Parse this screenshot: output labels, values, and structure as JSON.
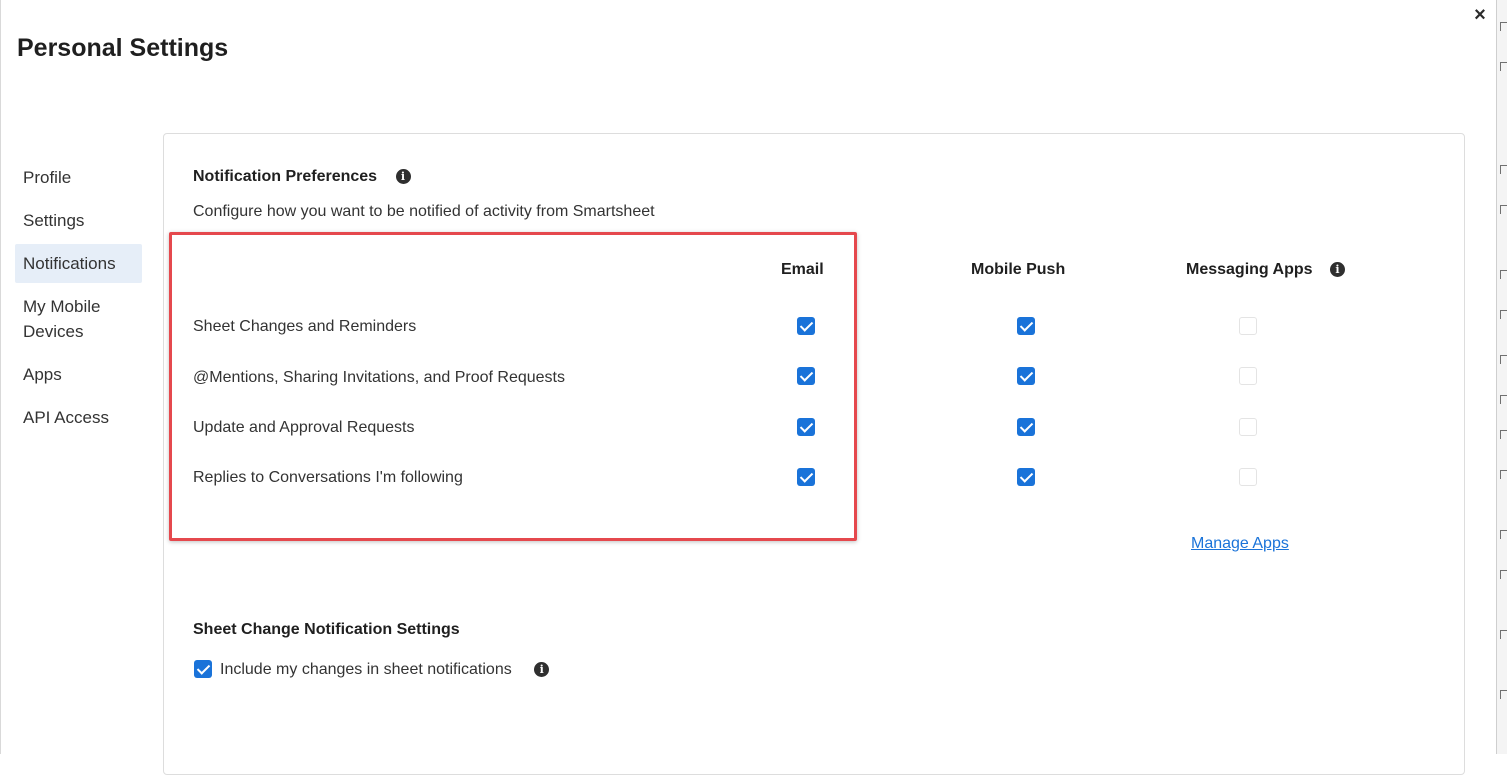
{
  "dialog": {
    "title": "Personal Settings",
    "close_label": "×"
  },
  "sidebar": {
    "items": [
      {
        "label": "Profile"
      },
      {
        "label": "Settings"
      },
      {
        "label": "Notifications",
        "active": true
      },
      {
        "label": "My Mobile Devices"
      },
      {
        "label": "Apps"
      },
      {
        "label": "API Access"
      }
    ]
  },
  "notification_preferences": {
    "title": "Notification Preferences",
    "info_icon": "info-icon",
    "subtitle": "Configure how you want to be notified of activity from Smartsheet",
    "columns": {
      "email": "Email",
      "mobile_push": "Mobile Push",
      "messaging_apps": "Messaging Apps"
    },
    "rows": [
      {
        "label": "Sheet Changes and Reminders",
        "email": true,
        "mobile_push": true,
        "messaging_apps": false
      },
      {
        "label": "@Mentions, Sharing Invitations, and Proof Requests",
        "email": true,
        "mobile_push": true,
        "messaging_apps": false
      },
      {
        "label": "Update and Approval Requests",
        "email": true,
        "mobile_push": true,
        "messaging_apps": false
      },
      {
        "label": "Replies to Conversations I'm following",
        "email": true,
        "mobile_push": true,
        "messaging_apps": false
      }
    ],
    "manage_apps_link": "Manage Apps"
  },
  "sheet_change_settings": {
    "title": "Sheet Change Notification Settings",
    "include_my_changes_label": "Include my changes in sheet notifications",
    "include_my_changes_checked": true
  },
  "colors": {
    "accent": "#1a73d9",
    "highlight_border": "#e5484d",
    "active_nav_bg": "#e6eef8"
  }
}
